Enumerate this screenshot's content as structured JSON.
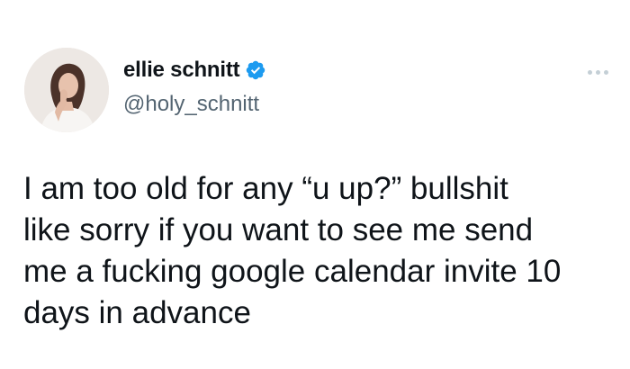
{
  "author": {
    "display_name": "ellie schnitt",
    "handle": "@holy_schnitt",
    "verified_icon": "verified-badge-icon",
    "avatar_icon": "profile-photo"
  },
  "tweet": {
    "text": "I am too old for any “u up?” bullshit\nlike sorry if you want to see me send\nme a fucking google calendar invite 10\ndays in advance"
  },
  "menu": {
    "icon": "more-options-icon"
  },
  "colors": {
    "text": "#0f1419",
    "handle": "#536471",
    "verified": "#1d9bf0",
    "background": "#ffffff"
  }
}
